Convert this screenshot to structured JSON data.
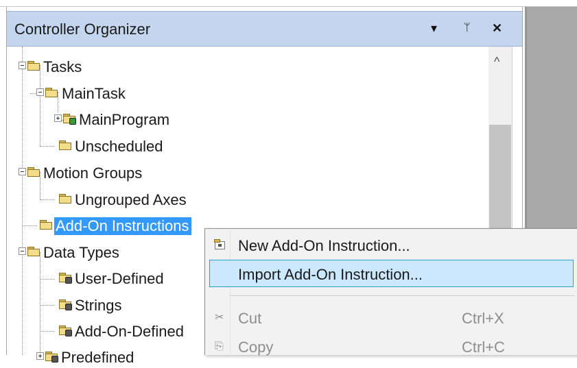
{
  "panel": {
    "title": "Controller Organizer",
    "buttons": {
      "dropdown": "▾",
      "pin": "ᛘ",
      "close": "✕"
    },
    "scroll_up": "^"
  },
  "tree": {
    "items": [
      {
        "label": "Tasks",
        "expander": "minus",
        "selected": false
      },
      {
        "label": "MainTask",
        "expander": "minus",
        "selected": false
      },
      {
        "label": "MainProgram",
        "expander": "plus",
        "selected": false
      },
      {
        "label": "Unscheduled",
        "expander": "none",
        "selected": false
      },
      {
        "label": "Motion Groups",
        "expander": "minus",
        "selected": false
      },
      {
        "label": "Ungrouped Axes",
        "expander": "none",
        "selected": false
      },
      {
        "label": "Add-On Instructions",
        "expander": "none",
        "selected": true
      },
      {
        "label": "Data Types",
        "expander": "minus",
        "selected": false
      },
      {
        "label": "User-Defined",
        "expander": "none",
        "selected": false
      },
      {
        "label": "Strings",
        "expander": "none",
        "selected": false
      },
      {
        "label": "Add-On-Defined",
        "expander": "none",
        "selected": false
      },
      {
        "label": "Predefined",
        "expander": "plus",
        "selected": false
      }
    ]
  },
  "context_menu": {
    "items": [
      {
        "label": "New Add-On Instruction...",
        "shortcut": "",
        "enabled": true,
        "highlighted": false
      },
      {
        "label": "Import Add-On Instruction...",
        "shortcut": "",
        "enabled": true,
        "highlighted": true
      },
      {
        "label": "Cut",
        "shortcut": "Ctrl+X",
        "enabled": false,
        "highlighted": false
      },
      {
        "label": "Copy",
        "shortcut": "Ctrl+C",
        "enabled": false,
        "highlighted": false
      }
    ],
    "icons": {
      "cut": "✂",
      "copy": "⎘"
    }
  },
  "colors": {
    "title_bar": "#c4d6ee",
    "selection": "#3399ff",
    "menu_highlight": "#cce8ff",
    "menu_highlight_border": "#26a0da",
    "folder": "#f3dc8a"
  }
}
